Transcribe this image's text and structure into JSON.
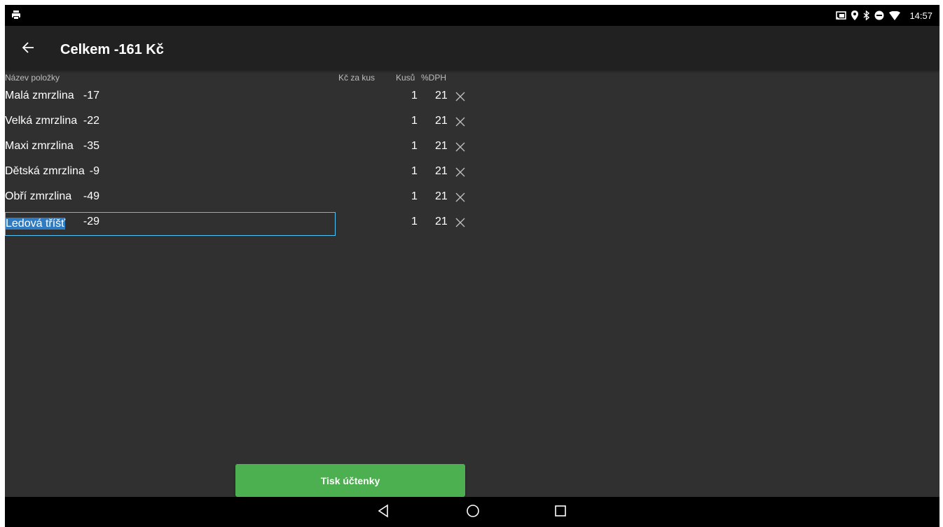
{
  "status_bar": {
    "time": "14:57",
    "icons": [
      "printer-icon",
      "cast-icon",
      "location-icon",
      "bluetooth-icon",
      "do-not-disturb-icon",
      "wifi-icon"
    ]
  },
  "app_bar": {
    "title": "Celkem -161 Kč"
  },
  "table": {
    "headers": {
      "name": "Název položky",
      "price": "Kč za kus",
      "qty": "Kusů",
      "vat": "%DPH"
    },
    "rows": [
      {
        "name": "Malá zmrzlina",
        "price": "-17",
        "qty": "1",
        "vat": "21"
      },
      {
        "name": "Velká zmrzlina",
        "price": "-22",
        "qty": "1",
        "vat": "21"
      },
      {
        "name": "Maxi zmrzlina",
        "price": "-35",
        "qty": "1",
        "vat": "21"
      },
      {
        "name": "Dětská zmrzlina",
        "price": "-9",
        "qty": "1",
        "vat": "21"
      },
      {
        "name": "Obří zmrzlina",
        "price": "-49",
        "qty": "1",
        "vat": "21"
      },
      {
        "name": "Ledová tříšť",
        "price": "-29",
        "qty": "1",
        "vat": "21"
      }
    ]
  },
  "print_button": {
    "label": "Tisk účtenky",
    "color": "#4caf50"
  },
  "colors": {
    "background": "#303030",
    "app_bar": "#212121",
    "selection_border": "#4fc3f7",
    "selection_highlight": "#2f7cc2"
  }
}
